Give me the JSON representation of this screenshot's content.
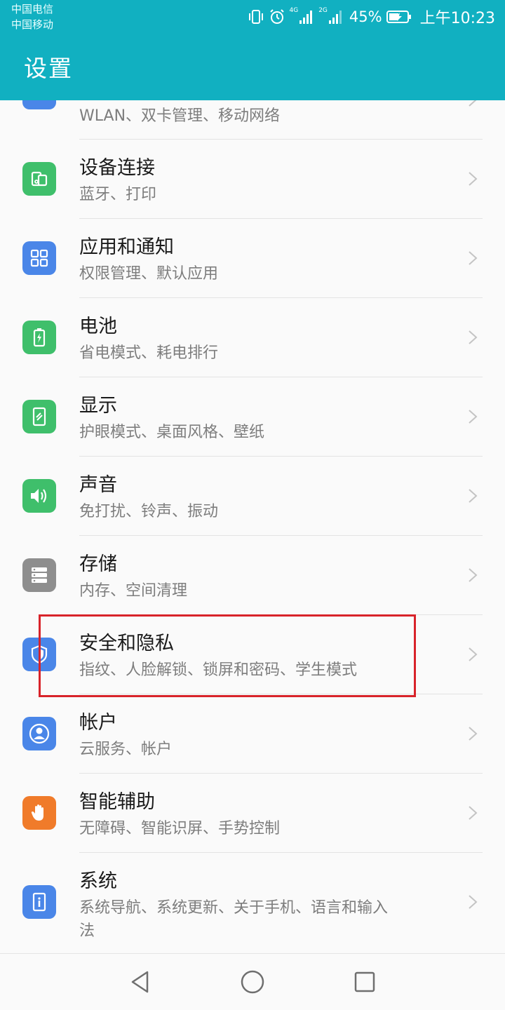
{
  "status_bar": {
    "carrier_1": "中国电信",
    "carrier_2": "中国移动",
    "network_1": "4G",
    "network_2": "2G",
    "battery_percent": "45%",
    "time": "上午10:23",
    "icons": [
      "vibrate-icon",
      "alarm-icon",
      "signal-4g-icon",
      "signal-2g-icon",
      "battery-charging-icon"
    ]
  },
  "header": {
    "title": "设置"
  },
  "settings": {
    "items": [
      {
        "id": "network",
        "title": "",
        "subtitle": "WLAN、双卡管理、移动网络",
        "icon": "network-icon",
        "color": "#4a86e8"
      },
      {
        "id": "device-connection",
        "title": "设备连接",
        "subtitle": "蓝牙、打印",
        "icon": "device-connection-icon",
        "color": "#3fbf6b"
      },
      {
        "id": "apps-notifications",
        "title": "应用和通知",
        "subtitle": "权限管理、默认应用",
        "icon": "apps-grid-icon",
        "color": "#4a86e8"
      },
      {
        "id": "battery",
        "title": "电池",
        "subtitle": "省电模式、耗电排行",
        "icon": "battery-icon",
        "color": "#3fbf6b"
      },
      {
        "id": "display",
        "title": "显示",
        "subtitle": "护眼模式、桌面风格、壁纸",
        "icon": "display-icon",
        "color": "#3fbf6b"
      },
      {
        "id": "sound",
        "title": "声音",
        "subtitle": "免打扰、铃声、振动",
        "icon": "speaker-icon",
        "color": "#3fbf6b"
      },
      {
        "id": "storage",
        "title": "存储",
        "subtitle": "内存、空间清理",
        "icon": "storage-icon",
        "color": "#8e8e8e"
      },
      {
        "id": "security-privacy",
        "title": "安全和隐私",
        "subtitle": "指纹、人脸解锁、锁屏和密码、学生模式",
        "icon": "shield-icon",
        "color": "#4a86e8"
      },
      {
        "id": "accounts",
        "title": "帐户",
        "subtitle": "云服务、帐户",
        "icon": "account-icon",
        "color": "#4a86e8"
      },
      {
        "id": "smart-assist",
        "title": "智能辅助",
        "subtitle": "无障碍、智能识屏、手势控制",
        "icon": "hand-icon",
        "color": "#f07b2a"
      },
      {
        "id": "system",
        "title": "系统",
        "subtitle": "系统导航、系统更新、关于手机、语言和输入",
        "subtitle_line2": "法",
        "icon": "info-icon",
        "color": "#4a86e8"
      }
    ]
  },
  "highlight": {
    "target": "security-privacy",
    "color": "#d8232a"
  },
  "nav_bar": {
    "buttons": [
      "back-icon",
      "home-icon",
      "recents-icon"
    ]
  },
  "theme": {
    "accent": "#11b0c1"
  }
}
